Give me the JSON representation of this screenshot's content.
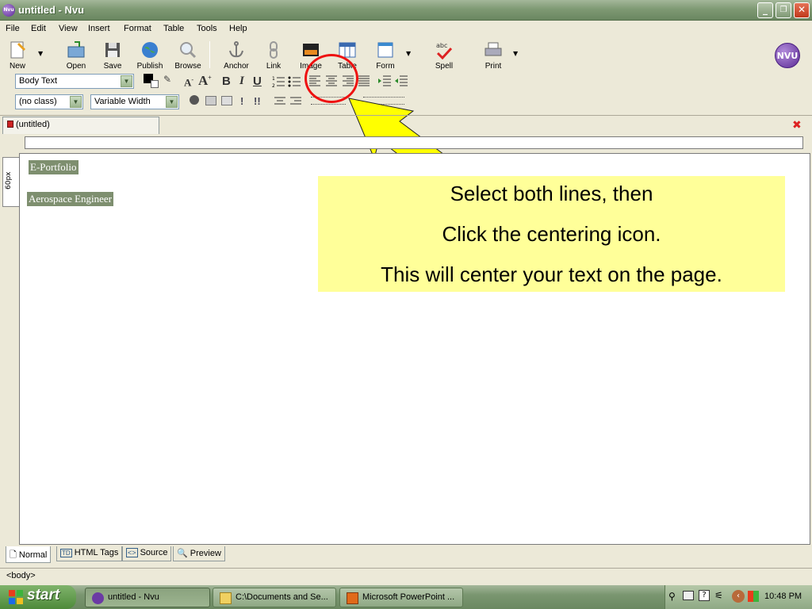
{
  "window": {
    "title": "untitled - Nvu",
    "app_icon": "Nvu",
    "buttons": {
      "minimize": "_",
      "maximize": "❐",
      "close": "✕"
    }
  },
  "menu": [
    "File",
    "Edit",
    "View",
    "Insert",
    "Format",
    "Table",
    "Tools",
    "Help"
  ],
  "toolbar": {
    "buttons": [
      {
        "label": "New",
        "icon": "new-page-icon"
      },
      {
        "label": "Open",
        "icon": "open-folder-icon"
      },
      {
        "label": "Save",
        "icon": "floppy-disk-icon"
      },
      {
        "label": "Publish",
        "icon": "globe-icon"
      },
      {
        "label": "Browse",
        "icon": "magnifier-icon"
      },
      {
        "label": "Anchor",
        "icon": "anchor-icon"
      },
      {
        "label": "Link",
        "icon": "chain-link-icon"
      },
      {
        "label": "Image",
        "icon": "image-icon"
      },
      {
        "label": "Table",
        "icon": "table-icon"
      },
      {
        "label": "Form",
        "icon": "form-icon"
      },
      {
        "label": "Spell",
        "icon": "spell-check-icon"
      },
      {
        "label": "Print",
        "icon": "printer-icon"
      }
    ],
    "logo": "NVU"
  },
  "format_bar": {
    "paragraph_style": "Body Text",
    "bold": "B",
    "italic": "I",
    "underline": "U",
    "class_select": "(no class)",
    "width_select": "Variable Width",
    "important": "!",
    "very_important": "!!"
  },
  "document_tab": "(untitled)",
  "side_tab": "60px",
  "document": {
    "lines": [
      "E-Portfolio",
      "Aerospace Engineer"
    ]
  },
  "callout": {
    "lines": [
      "Select both lines, then",
      "Click the centering icon.",
      "This will center your text on the page."
    ]
  },
  "edit_modes": [
    "Normal",
    "HTML Tags",
    "Source",
    "Preview"
  ],
  "status": "<body>",
  "taskbar": {
    "start": "start",
    "tasks": [
      "untitled - Nvu",
      "C:\\Documents and Se...",
      "Microsoft PowerPoint ..."
    ],
    "clock": "10:48 PM"
  },
  "colors": {
    "callout_bg": "#ffff99",
    "arrow": "#ffff00",
    "circle": "#ee1111",
    "selection": "#7e8f6f"
  }
}
